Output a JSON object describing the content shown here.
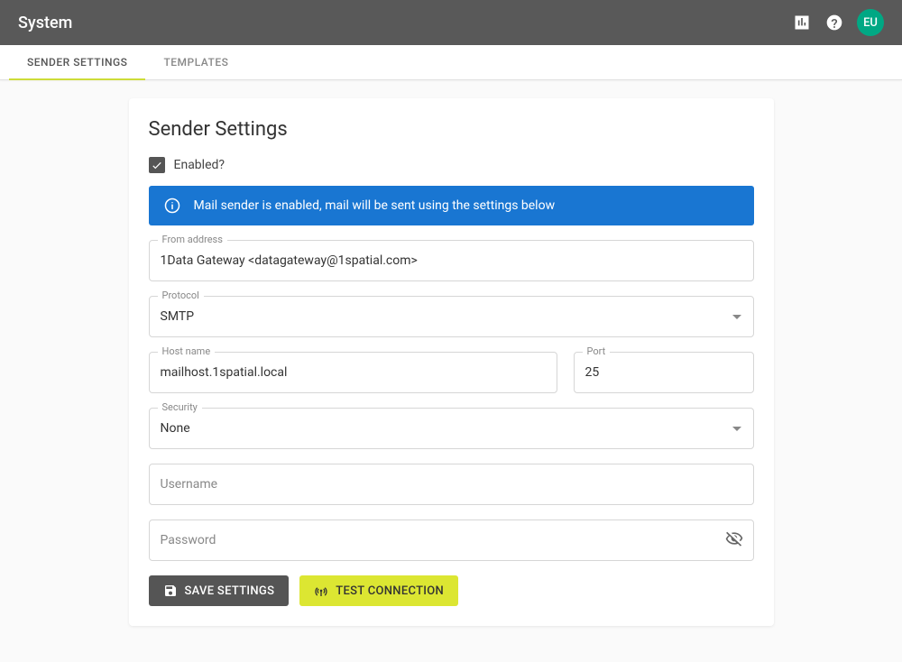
{
  "header": {
    "title": "System",
    "avatar": "EU"
  },
  "tabs": [
    {
      "label": "SENDER SETTINGS",
      "active": true
    },
    {
      "label": "TEMPLATES",
      "active": false
    }
  ],
  "card": {
    "title": "Sender Settings",
    "enabled_label": "Enabled?",
    "enabled_checked": true
  },
  "banner": {
    "text": "Mail sender is enabled, mail will be sent using the settings below"
  },
  "fields": {
    "from": {
      "label": "From address",
      "value": "1Data Gateway <datagateway@1spatial.com>"
    },
    "protocol": {
      "label": "Protocol",
      "value": "SMTP"
    },
    "host": {
      "label": "Host name",
      "value": "mailhost.1spatial.local"
    },
    "port": {
      "label": "Port",
      "value": "25"
    },
    "security": {
      "label": "Security",
      "value": "None"
    },
    "username": {
      "placeholder": "Username",
      "value": ""
    },
    "password": {
      "placeholder": "Password",
      "value": ""
    }
  },
  "buttons": {
    "save": "SAVE SETTINGS",
    "test": "TEST CONNECTION"
  }
}
